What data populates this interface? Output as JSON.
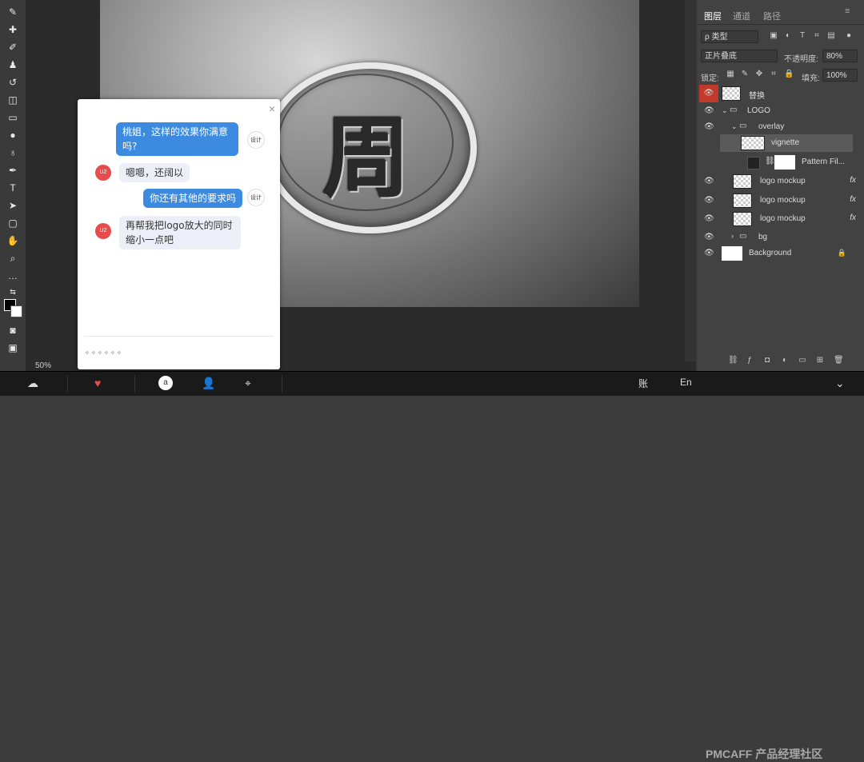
{
  "app": {
    "zoom": "50%"
  },
  "panel": {
    "tabs": [
      "图层",
      "通道",
      "路径"
    ],
    "filter": "ρ 类型",
    "blend_mode": "正片叠底",
    "opacity_label": "不透明度:",
    "opacity_value": "80%",
    "lock_label": "锁定:",
    "fill_label": "填充:",
    "fill_value": "100%",
    "layers": [
      {
        "name": "替换"
      },
      {
        "name": "LOGO"
      },
      {
        "name": "overlay"
      },
      {
        "name": "vignette"
      },
      {
        "name": "Pattern Fil..."
      },
      {
        "name": "logo mockup"
      },
      {
        "name": "logo mockup"
      },
      {
        "name": "logo mockup"
      },
      {
        "name": "bg"
      },
      {
        "name": "Background"
      }
    ],
    "fx_label": "fx"
  },
  "canvas": {
    "logo_char": "周"
  },
  "chat": {
    "close": "×",
    "messages": [
      {
        "from": "me",
        "text": "桃姐，这样的效果你满意吗?"
      },
      {
        "from": "them",
        "text": "嗯嗯，还阔以"
      },
      {
        "from": "me",
        "text": "你还有其他的要求吗"
      },
      {
        "from": "them",
        "text": "再帮我把logo放大的同时缩小一点吧"
      }
    ],
    "avatar_them": "U2",
    "avatar_me": "设计",
    "input_dots": "。。。。。。"
  },
  "taskbar": {
    "watermark": "PMCAFF 产品经理社区",
    "lang1": "账",
    "lang2": "En"
  }
}
